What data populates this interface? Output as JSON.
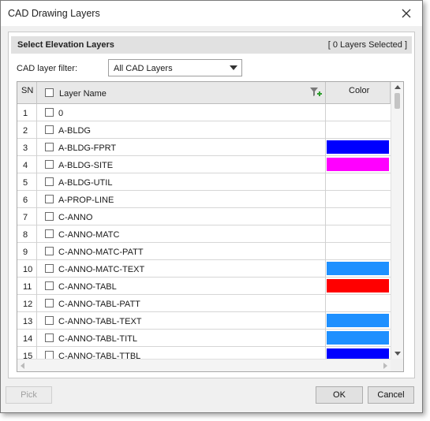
{
  "window": {
    "title": "CAD Drawing Layers"
  },
  "section": {
    "title": "Select Elevation Layers",
    "selected_count": "[ 0 Layers Selected ]"
  },
  "filter": {
    "label": "CAD layer filter:",
    "value": "All CAD Layers"
  },
  "grid": {
    "headers": {
      "sn": "SN",
      "name": "Layer Name",
      "color": "Color"
    },
    "rows": [
      {
        "sn": "1",
        "name": "0",
        "color": null
      },
      {
        "sn": "2",
        "name": "A-BLDG",
        "color": null
      },
      {
        "sn": "3",
        "name": "A-BLDG-FPRT",
        "color": "#0000ff"
      },
      {
        "sn": "4",
        "name": "A-BLDG-SITE",
        "color": "#ff00ff"
      },
      {
        "sn": "5",
        "name": "A-BLDG-UTIL",
        "color": null
      },
      {
        "sn": "6",
        "name": "A-PROP-LINE",
        "color": null
      },
      {
        "sn": "7",
        "name": "C-ANNO",
        "color": null
      },
      {
        "sn": "8",
        "name": "C-ANNO-MATC",
        "color": null
      },
      {
        "sn": "9",
        "name": "C-ANNO-MATC-PATT",
        "color": null
      },
      {
        "sn": "10",
        "name": "C-ANNO-MATC-TEXT",
        "color": "#1e90ff"
      },
      {
        "sn": "11",
        "name": "C-ANNO-TABL",
        "color": "#ff0000"
      },
      {
        "sn": "12",
        "name": "C-ANNO-TABL-PATT",
        "color": null
      },
      {
        "sn": "13",
        "name": "C-ANNO-TABL-TEXT",
        "color": "#1e90ff"
      },
      {
        "sn": "14",
        "name": "C-ANNO-TABL-TITL",
        "color": "#1e90ff"
      },
      {
        "sn": "15",
        "name": "C-ANNO-TABL-TTBL",
        "color": "#0000ff"
      }
    ]
  },
  "buttons": {
    "pick": "Pick",
    "ok": "OK",
    "cancel": "Cancel"
  },
  "icons": {
    "close": "close-icon",
    "filter": "filter-add-icon",
    "dropdown": "chevron-down-icon"
  }
}
